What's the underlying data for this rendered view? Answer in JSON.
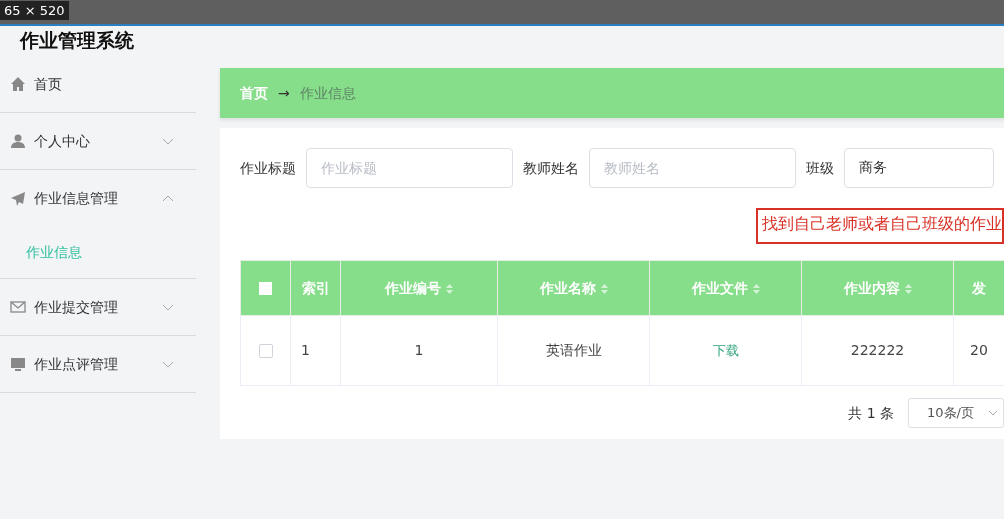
{
  "top_strip": {
    "dimension_label": "65 × 520"
  },
  "app_title": "作业管理系统",
  "sidebar": {
    "items": [
      {
        "label": "首页",
        "kind": "home"
      },
      {
        "label": "个人中心",
        "kind": "user",
        "expanded": false
      },
      {
        "label": "作业信息管理",
        "kind": "send",
        "expanded": true,
        "children": [
          {
            "label": "作业信息",
            "selected": true
          }
        ]
      },
      {
        "label": "作业提交管理",
        "kind": "mail",
        "expanded": false
      },
      {
        "label": "作业点评管理",
        "kind": "monitor",
        "expanded": false
      }
    ]
  },
  "breadcrumb": {
    "home": "首页",
    "separator": "→",
    "current": "作业信息"
  },
  "search": {
    "fields": [
      {
        "label": "作业标题",
        "placeholder": "作业标题"
      },
      {
        "label": "教师姓名",
        "placeholder": "教师姓名"
      },
      {
        "label": "班级",
        "value": "商务"
      }
    ]
  },
  "annotation": "找到自己老师或者自己班级的作业",
  "table": {
    "header_checked": false,
    "columns": [
      {
        "label": "索引",
        "sortable": false,
        "kind": "text"
      },
      {
        "label": "作业编号",
        "sortable": true,
        "kind": "text"
      },
      {
        "label": "作业名称",
        "sortable": true,
        "kind": "text"
      },
      {
        "label": "作业文件",
        "sortable": true,
        "kind": "link"
      },
      {
        "label": "作业内容",
        "sortable": true,
        "kind": "text"
      },
      {
        "label": "发",
        "sortable": false,
        "kind": "text"
      }
    ],
    "rows": [
      {
        "checked": false,
        "cells": [
          "1",
          "1",
          "英语作业",
          "下载",
          "222222",
          "20"
        ]
      }
    ]
  },
  "pagination": {
    "total": "共 1 条",
    "page_size": "10条/页"
  }
}
